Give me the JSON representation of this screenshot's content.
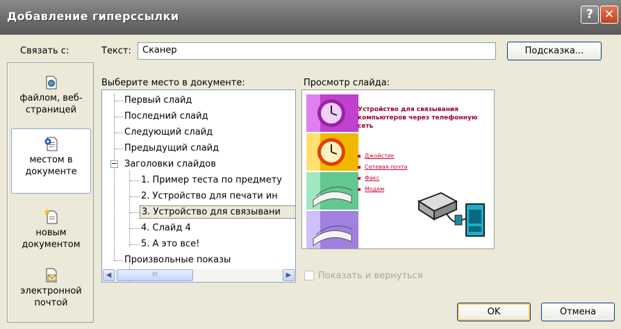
{
  "window": {
    "title": "Добавление гиперссылки",
    "help_icon": "question-icon",
    "close_icon": "close-icon"
  },
  "link_with_label": "Связать с:",
  "text_field": {
    "label": "Текст:",
    "value": "Сканер"
  },
  "hint_button": "Подсказка...",
  "link_bar": {
    "items": [
      {
        "label": "файлом, веб-страницей",
        "line1": "файлом, веб-",
        "line2": "страницей",
        "icon": "web-page-icon",
        "selected": false
      },
      {
        "label": "местом в документе",
        "line1": "местом в",
        "line2": "документе",
        "icon": "document-place-icon",
        "selected": true
      },
      {
        "label": "новым документом",
        "line1": "новым",
        "line2": "документом",
        "icon": "new-document-icon",
        "selected": false
      },
      {
        "label": "электронной почтой",
        "line1": "электронной",
        "line2": "почтой",
        "icon": "email-icon",
        "selected": false
      }
    ]
  },
  "tree": {
    "label": "Выберите место в документе:",
    "items": [
      "Первый слайд",
      "Последний слайд",
      "Следующий слайд",
      "Предыдущий слайд",
      "Заголовки слайдов",
      "1. Пример теста по предмету",
      "2. Устройство для печати ин",
      "3. Устройство для связывани",
      "4. Слайд 4",
      "5. А это все!",
      "Произвольные показы"
    ],
    "selected_index": 7,
    "expander_symbol": "−",
    "scroll_left_icon": "scroll-left-arrow-icon",
    "scroll_right_icon": "scroll-right-arrow-icon",
    "scroll_thumb_grip": "III"
  },
  "preview": {
    "label": "Просмотр слайда:",
    "slide_title": "Устройство для связывания компьютеров через телефонную сеть",
    "bullets": [
      "Джойстик",
      "Сетевая почта",
      "Факс",
      "Модем"
    ],
    "device_image": "modem-phone-illustration"
  },
  "show_and_return": {
    "label": "Показать и вернуться",
    "checked": false,
    "enabled": false
  },
  "ok_button": "OK",
  "cancel_button": "Отмена",
  "colors": {
    "dialog_bg": "#ece9d8",
    "title_bar": "#6f6f6f",
    "selection_border": "#8aa8c8",
    "slide_text": "#990033"
  }
}
